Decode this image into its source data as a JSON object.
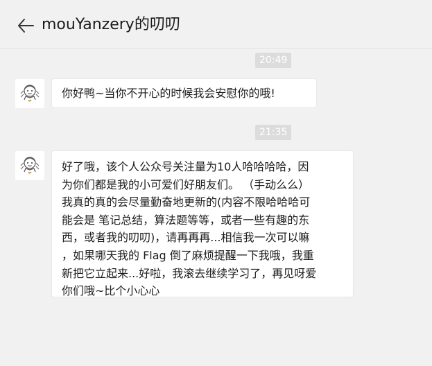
{
  "header": {
    "back_icon": "arrow-left-icon",
    "title": "mouYanzery的叨叨"
  },
  "messages": [
    {
      "time": "20:49",
      "avatar": "cartoon-avatar",
      "lines": [
        "你好鸭~当你不开心的时候我会安慰你的哦!"
      ]
    },
    {
      "time": "21:35",
      "avatar": "cartoon-avatar",
      "lines": [
        "好了哦，该个人公众号关注量为10人哈哈哈哈，因",
        "为你们都是我的小可爱们好朋友们。 （手动么么）",
        "我真的真的会尽量勤奋地更新的(内容不限哈哈哈可",
        "能会是 笔记总结，算法题等等，或者一些有趣的东",
        "西，或者我的叨叨)，请再再再...相信我一次可以嘛",
        "，如果哪天我的 Flag 倒了麻烦提醒一下我哦，我重",
        "新把它立起来...好啦，我滚去继续学习了，再见呀爱",
        "你们哦~比个小心心"
      ]
    }
  ],
  "colors": {
    "background": "#f1f1f1",
    "bubble": "#ffffff",
    "timestamp_bg": "#dcdcdc"
  }
}
